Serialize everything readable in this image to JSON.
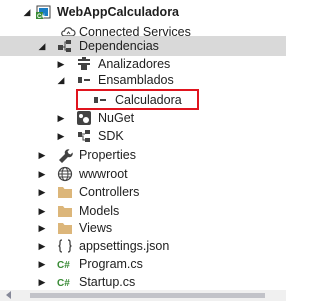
{
  "tree": {
    "project": "WebAppCalculadora",
    "connected_services": "Connected Services",
    "dependencias": "Dependencias",
    "analizadores": "Analizadores",
    "ensamblados": "Ensamblados",
    "calculadora": "Calculadora",
    "nuget": "NuGet",
    "sdk": "SDK",
    "properties": "Properties",
    "wwwroot": "wwwroot",
    "controllers": "Controllers",
    "models": "Models",
    "views": "Views",
    "appsettings": "appsettings.json",
    "program": "Program.cs",
    "startup": "Startup.cs"
  },
  "icon_names": {
    "project": "csharp-project-icon",
    "connected_services": "cloud-icon",
    "dependencias": "dependencies-icon",
    "analizadores": "analyzer-icon",
    "ensamblados": "assembly-icon",
    "calculadora": "assembly-reference-icon",
    "nuget": "nuget-icon",
    "sdk": "sdk-icon",
    "properties": "wrench-icon",
    "wwwroot": "globe-icon",
    "folder": "folder-icon",
    "json": "json-file-icon",
    "csharp": "csharp-file-icon"
  },
  "colors": {
    "selection_background": "#d9d9d9",
    "highlight_border": "#e0141e",
    "folder": "#dcb67a",
    "csharp": "#388a34",
    "project_blue": "#1a7dc4"
  }
}
